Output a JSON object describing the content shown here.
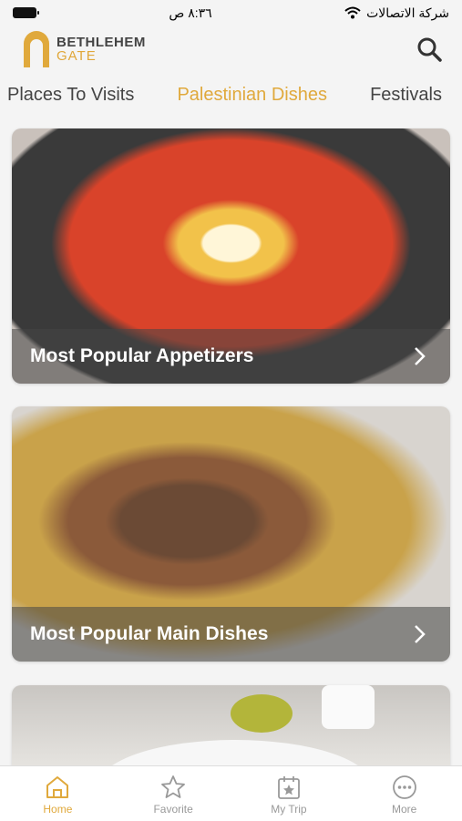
{
  "status_bar": {
    "time": "٨:٣٦ ص",
    "carrier": "شركة الاتصالات"
  },
  "header": {
    "logo_title": "BETHLEHEM",
    "logo_sub": "GATE"
  },
  "tabs": [
    {
      "label": "Places To Visits"
    },
    {
      "label": "Palestinian Dishes"
    },
    {
      "label": "Festivals"
    }
  ],
  "cards": [
    {
      "title": "Most Popular Appetizers"
    },
    {
      "title": "Most Popular Main Dishes"
    }
  ],
  "tab_bar": [
    {
      "label": "Home"
    },
    {
      "label": "Favorite"
    },
    {
      "label": "My Trip"
    },
    {
      "label": "More"
    }
  ],
  "colors": {
    "accent": "#e0a93c",
    "inactive": "#999999"
  }
}
